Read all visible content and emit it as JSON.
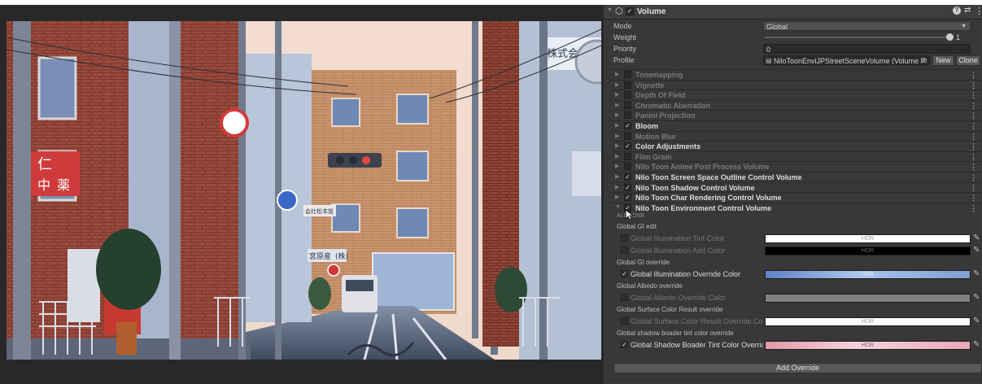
{
  "component": {
    "name": "Volume",
    "enabled": true,
    "help_icon": "help-icon",
    "preset_icon": "preset-icon",
    "menu_icon": "more-icon"
  },
  "fields": {
    "mode_label": "Mode",
    "mode_value": "Global",
    "weight_label": "Weight",
    "weight_value": "1",
    "weight_fraction": 1.0,
    "priority_label": "Priority",
    "priority_value": "0",
    "profile_label": "Profile",
    "profile_value": "NiloToonEnviJPStreetSceneVolume (Volume P",
    "new_button": "New",
    "clone_button": "Clone"
  },
  "overrides": [
    {
      "name": "Tonemapping",
      "enabled": false
    },
    {
      "name": "Vignette",
      "enabled": false
    },
    {
      "name": "Depth Of Field",
      "enabled": false
    },
    {
      "name": "Chromatic Aberration",
      "enabled": false
    },
    {
      "name": "Panini Projection",
      "enabled": false
    },
    {
      "name": "Bloom",
      "enabled": true
    },
    {
      "name": "Motion Blur",
      "enabled": false
    },
    {
      "name": "Color Adjustments",
      "enabled": true
    },
    {
      "name": "Film Grain",
      "enabled": false
    },
    {
      "name": "Nilo Toon Anime Post Process Volume",
      "enabled": false
    },
    {
      "name": "Nilo Toon Screen Space Outline Control Volume",
      "enabled": true
    },
    {
      "name": "Nilo Toon Shadow Control Volume",
      "enabled": true
    },
    {
      "name": "Nilo Toon Char Rendering Control Volume",
      "enabled": true
    },
    {
      "name": "Nilo Toon Environment Control Volume",
      "enabled": true
    }
  ],
  "env": {
    "all_none": "ALL NONE",
    "sections": [
      "Global GI edit",
      "Global GI override",
      "Global Albedo override",
      "Global Surface Color Result override",
      "Global shadow boader tint color override"
    ],
    "props": [
      {
        "name": "Global Illumination Tint Color",
        "enabled": false,
        "hdr": "HDR"
      },
      {
        "name": "Global Illumination Add Color",
        "enabled": false,
        "hdr": "HDR"
      },
      {
        "name": "Global Illumination Override Color",
        "enabled": true,
        "hdr": "HDR"
      },
      {
        "name": "Global Albedo Override Color",
        "enabled": false,
        "hdr": ""
      },
      {
        "name": "Global Surface Color Result Override Colo",
        "enabled": false,
        "hdr": "HDR"
      },
      {
        "name": "Global Shadow Boader Tint Color Override",
        "enabled": true,
        "hdr": "HDR"
      }
    ],
    "colors": [
      "#ffffff",
      "#000000",
      "gradient-blue",
      "#808080",
      "#ffffff",
      "gradient-pink"
    ]
  },
  "add_override_button": "Add Override",
  "scene_signs": {
    "shop_sign": "株式会",
    "sign_left_1": "仁",
    "sign_left_2": "中",
    "sign_left_3": "薬",
    "sign_center_1": "会社松本設",
    "sign_center_2": "(株)",
    "sign_center_3": "宮原産"
  }
}
